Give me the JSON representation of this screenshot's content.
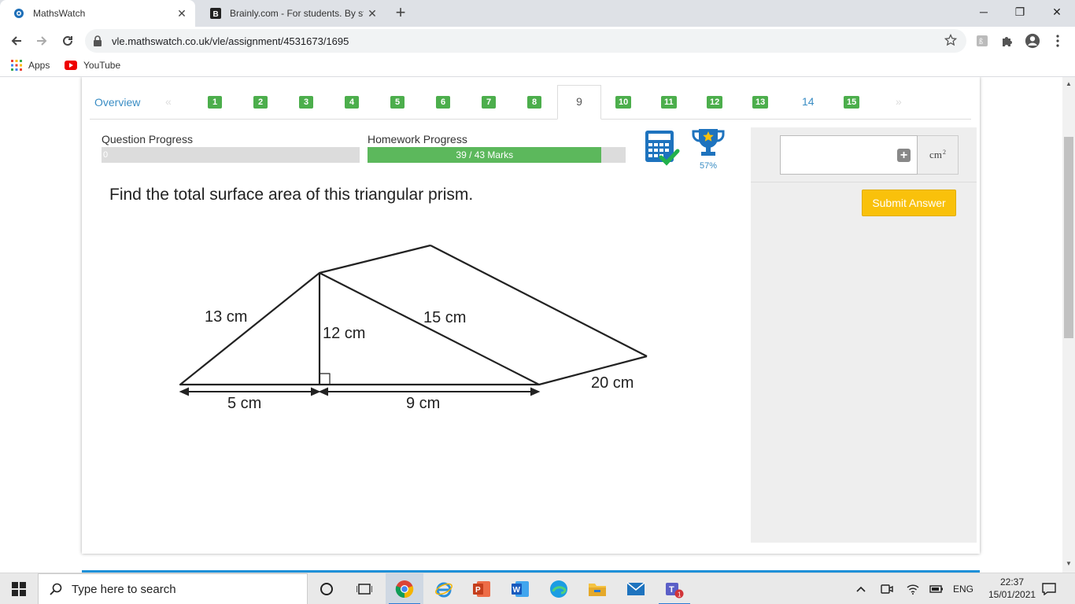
{
  "browser": {
    "tabs": [
      {
        "title": "MathsWatch",
        "active": true
      },
      {
        "title": "Brainly.com - For students. By stu",
        "active": false
      }
    ],
    "url": "vle.mathswatch.co.uk/vle/assignment/4531673/1695",
    "bookmarks": [
      {
        "label": "Apps",
        "icon": "apps-grid-icon"
      },
      {
        "label": "YouTube",
        "icon": "youtube-icon"
      }
    ]
  },
  "assignment": {
    "overview_label": "Overview",
    "prev_arrow": "«",
    "next_arrow": "»",
    "questions": [
      {
        "label": "1",
        "state": "correct"
      },
      {
        "label": "2",
        "state": "correct"
      },
      {
        "label": "3",
        "state": "correct"
      },
      {
        "label": "4",
        "state": "correct"
      },
      {
        "label": "5",
        "state": "correct"
      },
      {
        "label": "6",
        "state": "correct"
      },
      {
        "label": "7",
        "state": "correct"
      },
      {
        "label": "8",
        "state": "correct"
      },
      {
        "label": "9",
        "state": "current"
      },
      {
        "label": "10",
        "state": "correct"
      },
      {
        "label": "11",
        "state": "correct"
      },
      {
        "label": "12",
        "state": "correct"
      },
      {
        "label": "13",
        "state": "correct"
      },
      {
        "label": "14",
        "state": "unanswered"
      },
      {
        "label": "15",
        "state": "correct"
      }
    ],
    "question_progress": {
      "label": "Question Progress",
      "text": "0",
      "fraction": 0
    },
    "homework_progress": {
      "label": "Homework Progress",
      "text": "39 / 43 Marks",
      "fraction": 0.907
    },
    "trophy_percent": "57%",
    "question_text": "Find the total surface area of this triangular prism.",
    "diagram_labels": {
      "slant_left": "13 cm",
      "height": "12 cm",
      "slant_right": "15 cm",
      "base_left": "5 cm",
      "base_right": "9 cm",
      "length": "20 cm"
    },
    "answer": {
      "value": "",
      "unit": "cm",
      "unit_power": "2"
    },
    "submit_label": "Submit Answer"
  },
  "colors": {
    "correct_green": "#4cae4c",
    "progress_green": "#5cb85c",
    "link_blue": "#3a8dc4",
    "submit_yellow": "#f9c10b"
  },
  "taskbar": {
    "search_placeholder": "Type here to search",
    "language": "ENG",
    "time": "22:37",
    "date": "15/01/2021",
    "teams_badge": "1"
  }
}
